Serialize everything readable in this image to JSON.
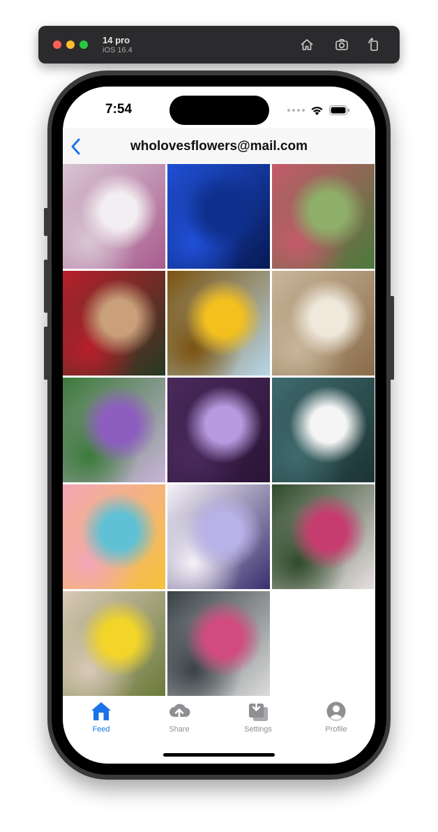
{
  "simulator": {
    "device_name": "14 pro",
    "os_version": "iOS 16.4",
    "toolbar_icons": [
      "home-icon",
      "screenshot-icon",
      "rotate-icon"
    ]
  },
  "status_bar": {
    "time": "7:54",
    "icons": [
      "signal-dots-icon",
      "wifi-icon",
      "battery-icon"
    ]
  },
  "nav": {
    "title": "wholovesflowers@mail.com",
    "back_icon": "chevron-left-icon",
    "accent": "#1a73e8"
  },
  "grid": {
    "photos": [
      {
        "subject": "white-pink-orchids",
        "colors": [
          "#f3eef1",
          "#d8c6d4",
          "#a85b8e"
        ]
      },
      {
        "subject": "blue-rose",
        "colors": [
          "#0e2f8c",
          "#1f4fd6",
          "#071a55"
        ]
      },
      {
        "subject": "flower-garden-topiary",
        "colors": [
          "#8fb06a",
          "#c65a6b",
          "#4a7a3a"
        ]
      },
      {
        "subject": "corgi-with-red-flowers",
        "colors": [
          "#c9a07a",
          "#b91f2b",
          "#253a22"
        ]
      },
      {
        "subject": "sunflowers",
        "colors": [
          "#f4c01e",
          "#7b5310",
          "#b7d6e8"
        ]
      },
      {
        "subject": "white-wooden-roses",
        "colors": [
          "#efe8db",
          "#c9b79a",
          "#8a6c4a"
        ]
      },
      {
        "subject": "purple-allium",
        "colors": [
          "#8d5dc0",
          "#3c7a3a",
          "#c9b4d9"
        ]
      },
      {
        "subject": "purple-daisy",
        "colors": [
          "#b79be0",
          "#4a2a5c",
          "#2a1436"
        ]
      },
      {
        "subject": "white-daisy",
        "colors": [
          "#f5f5f5",
          "#3f6b6e",
          "#1c3334"
        ]
      },
      {
        "subject": "gerbera-daisies-on-blue",
        "colors": [
          "#5fc0d6",
          "#f2a7b8",
          "#f5c23a"
        ]
      },
      {
        "subject": "purple-white-pansies",
        "colors": [
          "#b8b2e8",
          "#f5f2f8",
          "#3a2f6e"
        ]
      },
      {
        "subject": "pink-lily-bouquet",
        "colors": [
          "#c73c6e",
          "#2f4a2a",
          "#e7dfe0"
        ]
      },
      {
        "subject": "yellow-chrysanthemums-wrapped",
        "colors": [
          "#f3d52a",
          "#d9c9b8",
          "#6c7a3a"
        ]
      },
      {
        "subject": "pink-lilies-in-vase",
        "colors": [
          "#d24b7e",
          "#3a4246",
          "#dcdcdc"
        ]
      }
    ]
  },
  "tabbar": {
    "tabs": [
      {
        "label": "Feed",
        "icon": "house-icon",
        "active": true
      },
      {
        "label": "Share",
        "icon": "cloud-upload-icon",
        "active": false
      },
      {
        "label": "Settings",
        "icon": "tray-download-icon",
        "active": false
      },
      {
        "label": "Profile",
        "icon": "person-circle-icon",
        "active": false
      }
    ],
    "active_color": "#1a73e8",
    "inactive_color": "#8e8e93"
  }
}
